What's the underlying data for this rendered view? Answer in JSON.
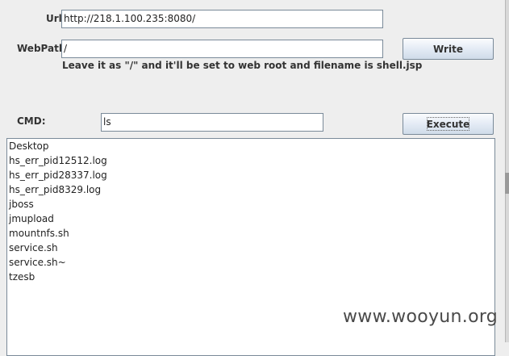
{
  "form": {
    "url_label": "Url:",
    "url_value": "http://218.1.100.235:8080/",
    "webpath_label": "WebPath:",
    "webpath_value": "/",
    "write_button": "Write",
    "hint": "Leave it as \"/\" and it'll be set to web root and filename is shell.jsp",
    "cmd_label": "CMD:",
    "cmd_value": "ls",
    "execute_button": "Execute"
  },
  "output": {
    "lines": [
      "Desktop",
      "hs_err_pid12512.log",
      "hs_err_pid28337.log",
      "hs_err_pid8329.log",
      "jboss",
      "jmupload",
      "mountnfs.sh",
      "service.sh",
      "service.sh~",
      "tzesb"
    ]
  },
  "watermark": "www.wooyun.org"
}
